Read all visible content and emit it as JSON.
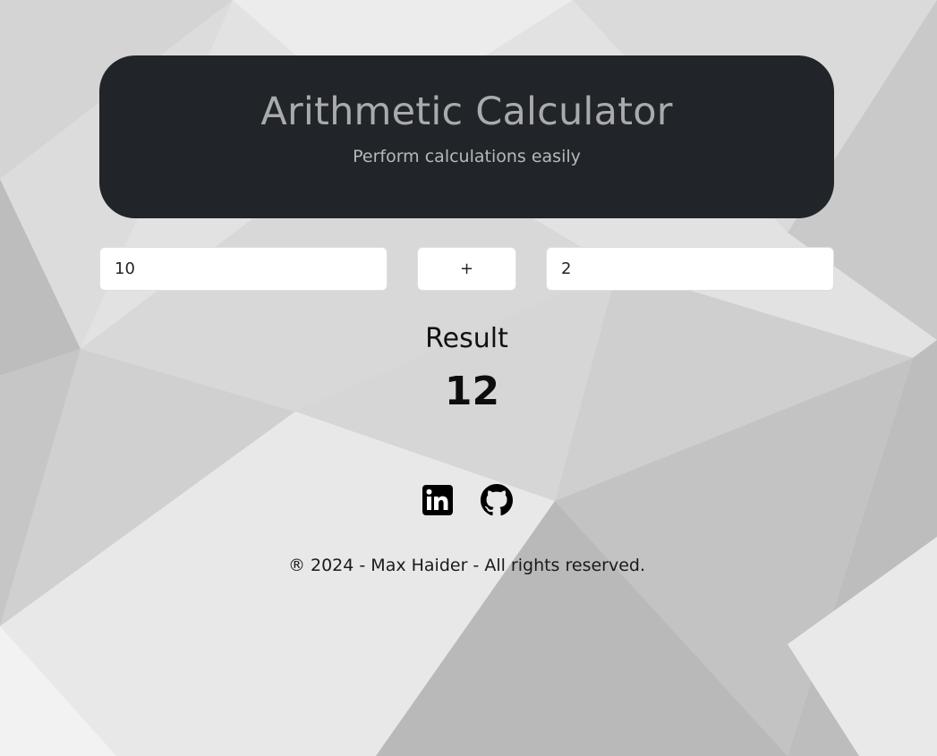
{
  "header": {
    "title": "Arithmetic Calculator",
    "subtitle": "Perform calculations easily"
  },
  "calculator": {
    "first_number": "10",
    "operator": "+",
    "second_number": "2"
  },
  "result": {
    "label": "Result",
    "value": "12"
  },
  "footer": {
    "social_icons": [
      "linkedin-icon",
      "github-icon"
    ],
    "copyright": "® 2024 - Max Haider - All rights reserved."
  },
  "colors": {
    "header_bg": "#212529",
    "header_title": "#a9aaab",
    "input_bg": "#ffffff"
  }
}
